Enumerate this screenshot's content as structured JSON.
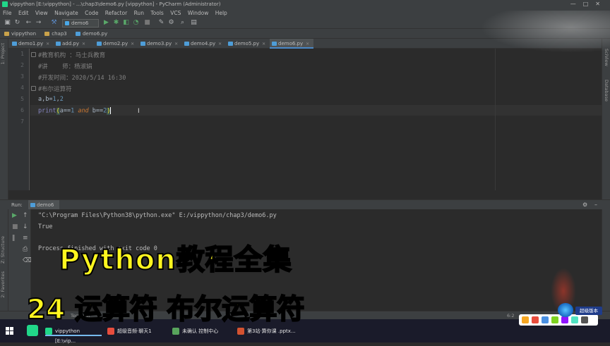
{
  "window": {
    "title": "vippython [E:\\vippython] - ...\\chap3\\demo6.py [vippython] - PyCharm (Administrator)",
    "controls": [
      "—",
      "□",
      "✕"
    ]
  },
  "menu": [
    "File",
    "Edit",
    "View",
    "Navigate",
    "Code",
    "Refactor",
    "Run",
    "Tools",
    "VCS",
    "Window",
    "Help"
  ],
  "toolbar": {
    "run_config": "demo6",
    "icons": [
      "save-icon",
      "sync-icon",
      "back-icon",
      "forward-icon",
      "run-icon",
      "debug-icon",
      "coverage-icon",
      "profile-icon",
      "stop-icon",
      "settings-icon",
      "search-icon",
      "structure-icon"
    ]
  },
  "breadcrumbs": [
    "vippython",
    "chap3",
    "demo6.py"
  ],
  "left_panel": {
    "project_label": "1: Project",
    "structure_label": "Z: Structure",
    "favorites_label": "2: Favorites"
  },
  "right_panel": {
    "sciview_label": "SciView",
    "database_label": "Database"
  },
  "tabs": [
    {
      "label": "demo1.py"
    },
    {
      "label": "add.py"
    },
    {
      "label": "demo2.py"
    },
    {
      "label": "demo3.py"
    },
    {
      "label": "demo4.py"
    },
    {
      "label": "demo5.py"
    },
    {
      "label": "demo6.py",
      "active": true
    }
  ],
  "editor": {
    "line_numbers": [
      "1",
      "2",
      "3",
      "4",
      "5",
      "6",
      "7"
    ],
    "lines": {
      "l1": "#教育机构 ：马士兵教育",
      "l2": "#讲    师：杨淑娟",
      "l3": "#开发时间：2020/5/14 16:30",
      "l4": "#布尔运算符",
      "l5_a": "a,b=",
      "l5_b": "1",
      "l5_c": ",",
      "l5_d": "2",
      "l6_fn": "print",
      "l6_open": "(",
      "l6_a": "a==",
      "l6_n1": "1",
      "l6_and": " and ",
      "l6_b": "b==",
      "l6_n2": "2",
      "l6_close": ")"
    }
  },
  "run_panel": {
    "label": "Run:",
    "tab": "demo6",
    "console": {
      "cmd": "\"C:\\Program Files\\Python38\\python.exe\" E:/vippython/chap3/demo6.py",
      "result": "True",
      "exit": "Process finished with exit code 0"
    }
  },
  "statusbar": {
    "text": "Terminal",
    "time": "6:2"
  },
  "overlay": {
    "line1": "Python教程全集",
    "line2": "24 运算符 布尔运算符"
  },
  "badge": "超级版本",
  "taskbar": {
    "items": [
      {
        "label": "vippython [E:\\vip...",
        "color": "#21d789",
        "active": true
      },
      {
        "label": "超级音频·聊天1",
        "color": "#e84d3d"
      },
      {
        "label": "未确认 控制中心",
        "color": "#58a45c"
      },
      {
        "label": "第3站·算你课 .pptx...",
        "color": "#d35230"
      }
    ]
  },
  "colors": {
    "background": "#2b2b2b",
    "comment": "#808080",
    "builtin": "#8888c6",
    "number": "#6897bb",
    "keyword": "#cc7832",
    "overlay_text": "#fff61f"
  }
}
